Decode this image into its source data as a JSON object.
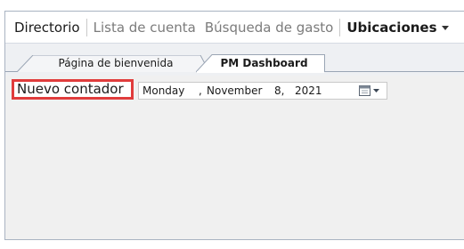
{
  "menu": {
    "items": [
      {
        "label": "Directorio"
      },
      {
        "label": "Lista de cuenta"
      },
      {
        "label": "Búsqueda de gasto"
      },
      {
        "label": "Ubicaciones"
      }
    ]
  },
  "tabs": [
    {
      "label": "Página de bienvenida",
      "active": false
    },
    {
      "label": "PM Dashboard",
      "active": true
    }
  ],
  "toolbar": {
    "new_counter_label": "Nuevo contador",
    "date": {
      "weekday": "Monday",
      "separator": ",",
      "month": "November",
      "day": "8,",
      "year": "2021"
    }
  },
  "colors": {
    "highlight": "#e03c3c",
    "border": "#a9b3c2",
    "muted_text": "#7b7b7b"
  },
  "icons": {
    "date_dropdown": "calendar-icon",
    "menu_caret": "chevron-down-icon"
  }
}
